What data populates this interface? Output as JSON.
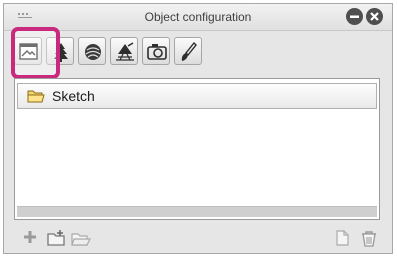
{
  "window": {
    "title": "Object configuration"
  },
  "toolbar": {
    "buttons": [
      {
        "icon": "canvas-image-icon",
        "selected": true
      },
      {
        "icon": "tree-icon",
        "selected": false
      },
      {
        "icon": "sphere-icon",
        "selected": false
      },
      {
        "icon": "perspective-object-icon",
        "selected": false
      },
      {
        "icon": "camera-icon",
        "selected": false
      },
      {
        "icon": "brush-icon",
        "selected": false
      }
    ]
  },
  "list": {
    "items": [
      {
        "label": "Sketch",
        "icon": "folder-icon"
      }
    ]
  },
  "bottom_toolbar": {
    "icons": [
      "add-icon",
      "new-folder-icon",
      "open-folder-icon",
      "new-page-icon",
      "delete-icon"
    ]
  },
  "colors": {
    "highlight": "#c92a7e",
    "panel_bg": "#e6e6e6"
  }
}
